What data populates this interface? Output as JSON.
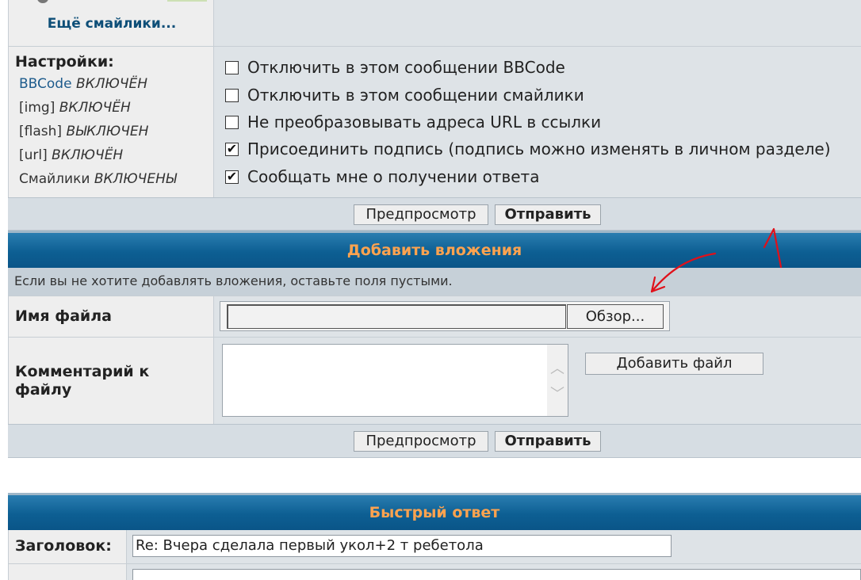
{
  "smilies": {
    "more_link": "Ещё смайлики..."
  },
  "settings": {
    "title": "Настройки:",
    "items": [
      {
        "name": "BBCode",
        "state": "ВКЛЮЧЁН"
      },
      {
        "name": "[img]",
        "state": "ВКЛЮЧЁН"
      },
      {
        "name": "[flash]",
        "state": "ВЫКЛЮЧЕН"
      },
      {
        "name": "[url]",
        "state": "ВКЛЮЧЁН"
      },
      {
        "name": "Смайлики",
        "state": "ВКЛЮЧЕНЫ"
      }
    ]
  },
  "options": [
    {
      "label": "Отключить в этом сообщении BBCode",
      "checked": false
    },
    {
      "label": "Отключить в этом сообщении смайлики",
      "checked": false
    },
    {
      "label": "Не преобразовывать адреса URL в ссылки",
      "checked": false
    },
    {
      "label": "Присоединить подпись (подпись можно изменять в личном разделе)",
      "checked": true
    },
    {
      "label": "Сообщать мне о получении ответа",
      "checked": true
    }
  ],
  "buttons": {
    "preview": "Предпросмотр",
    "submit": "Отправить"
  },
  "attachments": {
    "header": "Добавить вложения",
    "note": "Если вы не хотите добавлять вложения, оставьте поля пустыми.",
    "filename_label": "Имя файла",
    "browse_label": "Обзор...",
    "comment_label": "Комментарий к файлу",
    "add_file_label": "Добавить файл"
  },
  "quick_reply": {
    "header": "Быстрый ответ",
    "subject_label": "Заголовок:",
    "subject_value": "Re: Вчера сделала первый укол+2 т ребетола"
  },
  "colors": {
    "header_bg": "#0d5f93",
    "header_text": "#ffa34f",
    "annotation": "#e0101a"
  },
  "icons": {
    "checkmark": "check-icon",
    "scroll_up": "chevron-up-icon",
    "scroll_down": "chevron-down-icon"
  }
}
